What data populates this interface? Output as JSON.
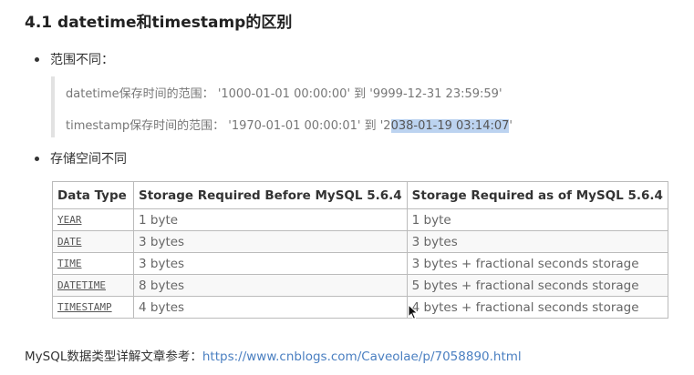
{
  "heading": "4.1 datetime和timestamp的区别",
  "bullets": {
    "range": "范围不同：",
    "storage": "存储空间不同"
  },
  "quote": {
    "datetime_line": "datetime保存时间的范围：  '1000-01-01 00:00:00' 到 '9999-12-31 23:59:59'",
    "timestamp_prefix": "timestamp保存时间的范围：  '1970-01-01 00:00:01' 到 '2",
    "timestamp_selected": "038-01-19 03:14:07",
    "timestamp_suffix": "'"
  },
  "table": {
    "headers": [
      "Data Type",
      "Storage Required Before MySQL 5.6.4",
      "Storage Required as of MySQL 5.6.4"
    ],
    "rows": [
      [
        "YEAR",
        "1 byte",
        "1 byte"
      ],
      [
        "DATE",
        "3 bytes",
        "3 bytes"
      ],
      [
        "TIME",
        "3 bytes",
        "3 bytes + fractional seconds storage"
      ],
      [
        "DATETIME",
        "8 bytes",
        "5 bytes + fractional seconds storage"
      ],
      [
        "TIMESTAMP",
        "4 bytes",
        "4 bytes + fractional seconds storage"
      ]
    ]
  },
  "reference": {
    "label": "MySQL数据类型详解文章参考：",
    "link": "https://www.cnblogs.com/Caveolae/p/7058890.html"
  },
  "icons": {
    "cursor": "mouse-pointer-icon"
  }
}
